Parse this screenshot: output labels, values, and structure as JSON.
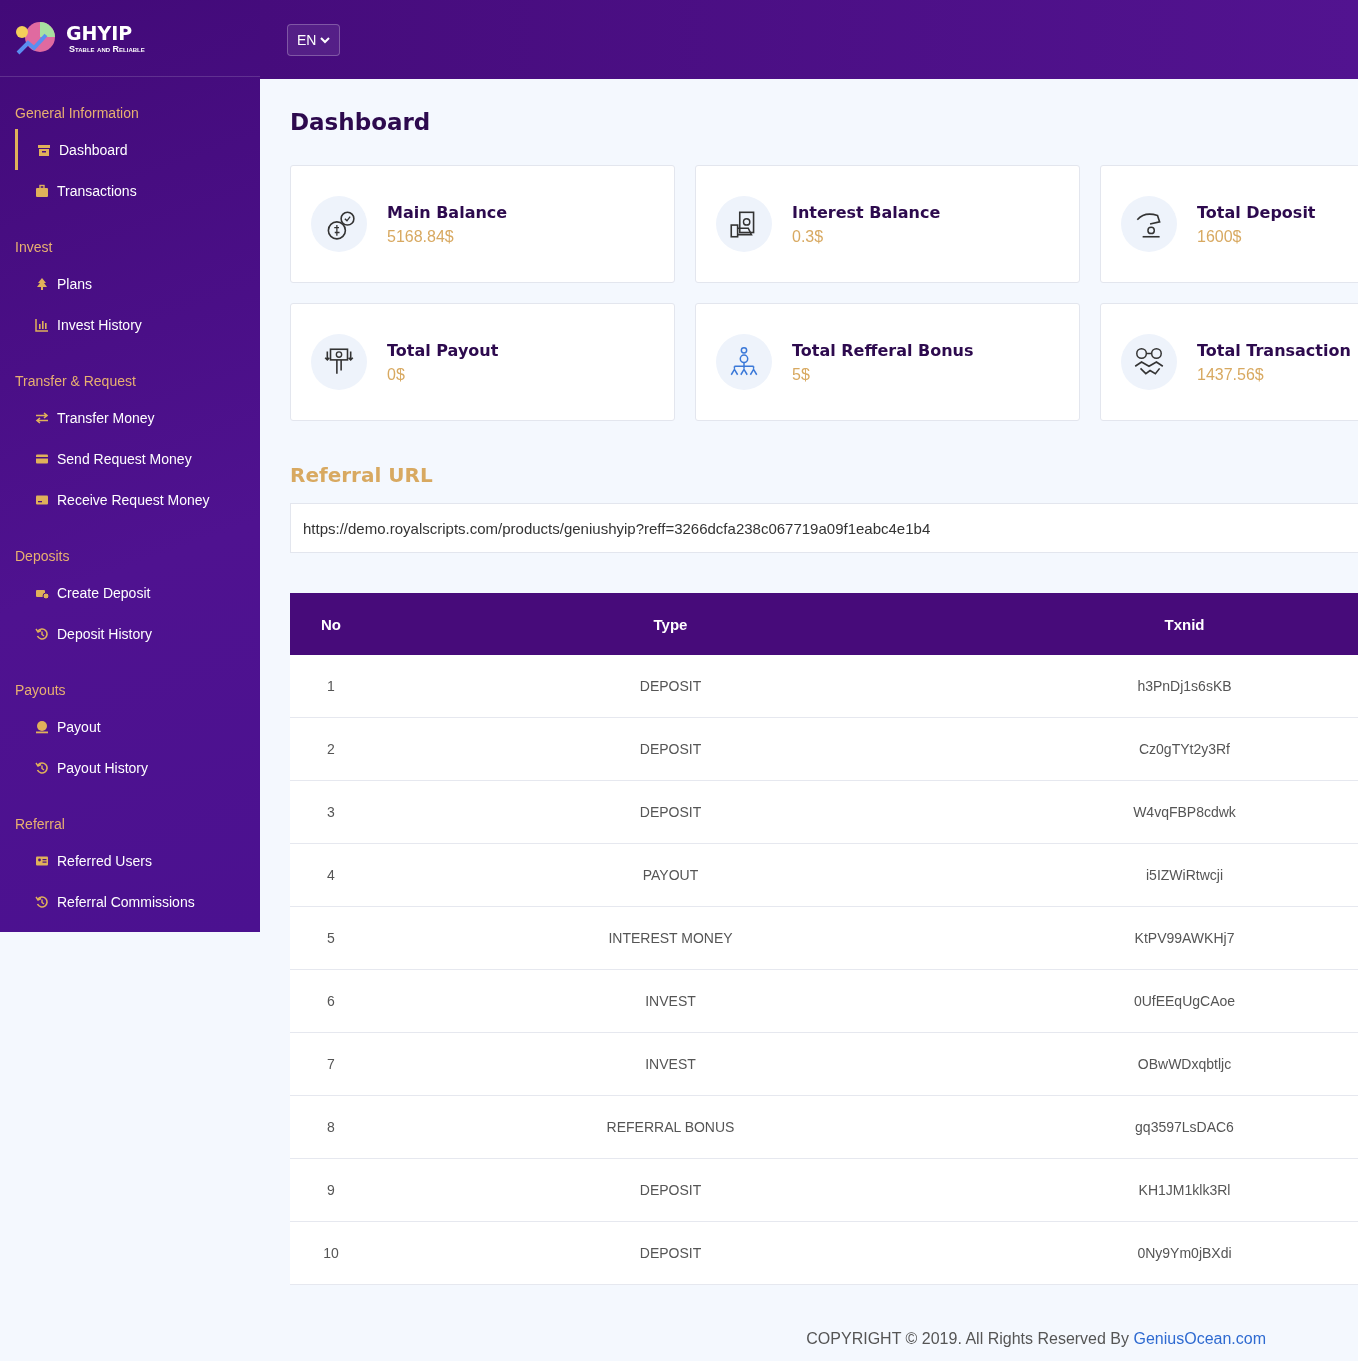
{
  "logo": {
    "name": "GHYIP",
    "tagline": "Stable and Reliable"
  },
  "language": {
    "value": "EN"
  },
  "sidebar": {
    "sections": [
      {
        "title": "General Information",
        "items": [
          {
            "label": "Dashboard",
            "selected": true
          },
          {
            "label": "Transactions",
            "selected": false
          }
        ]
      },
      {
        "title": "Invest",
        "items": [
          {
            "label": "Plans",
            "selected": false
          },
          {
            "label": "Invest History",
            "selected": false
          }
        ]
      },
      {
        "title": "Transfer & Request",
        "items": [
          {
            "label": "Transfer Money",
            "selected": false
          },
          {
            "label": "Send Request Money",
            "selected": false
          },
          {
            "label": "Receive Request Money",
            "selected": false
          }
        ]
      },
      {
        "title": "Deposits",
        "items": [
          {
            "label": "Create Deposit",
            "selected": false
          },
          {
            "label": "Deposit History",
            "selected": false
          }
        ]
      },
      {
        "title": "Payouts",
        "items": [
          {
            "label": "Payout",
            "selected": false
          },
          {
            "label": "Payout History",
            "selected": false
          }
        ]
      },
      {
        "title": "Referral",
        "items": [
          {
            "label": "Referred Users",
            "selected": false
          },
          {
            "label": "Referral Commissions",
            "selected": false
          }
        ]
      }
    ]
  },
  "page_title": "Dashboard",
  "stats": [
    {
      "title": "Main Balance",
      "value": "5168.84$"
    },
    {
      "title": "Interest Balance",
      "value": "0.3$"
    },
    {
      "title": "Total Deposit",
      "value": "1600$"
    },
    {
      "title": "Total Payout",
      "value": "0$"
    },
    {
      "title": "Total Refferal Bonus",
      "value": "5$"
    },
    {
      "title": "Total Transaction",
      "value": "1437.56$"
    }
  ],
  "referral": {
    "title": "Referral URL",
    "value": "https://demo.royalscripts.com/products/geniushyip?reff=3266dcfa238c067719a09f1eabc4e1b4"
  },
  "table": {
    "columns": [
      "No",
      "Type",
      "Txnid"
    ],
    "rows": [
      [
        "1",
        "DEPOSIT",
        "h3PnDj1s6sKB"
      ],
      [
        "2",
        "DEPOSIT",
        "Cz0gTYt2y3Rf"
      ],
      [
        "3",
        "DEPOSIT",
        "W4vqFBP8cdwk"
      ],
      [
        "4",
        "PAYOUT",
        "i5IZWiRtwcji"
      ],
      [
        "5",
        "INTEREST MONEY",
        "KtPV99AWKHj7"
      ],
      [
        "6",
        "INVEST",
        "0UfEEqUgCAoe"
      ],
      [
        "7",
        "INVEST",
        "OBwWDxqbtljc"
      ],
      [
        "8",
        "REFERRAL BONUS",
        "gq3597LsDAC6"
      ],
      [
        "9",
        "DEPOSIT",
        "KH1JM1klk3Rl"
      ],
      [
        "10",
        "DEPOSIT",
        "0Ny9Ym0jBXdi"
      ]
    ]
  },
  "footer": {
    "text": "COPYRIGHT © 2019. All Rights Reserved By",
    "link": "GeniusOcean.com"
  }
}
